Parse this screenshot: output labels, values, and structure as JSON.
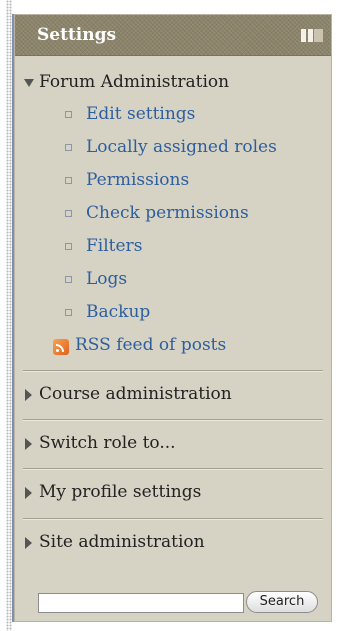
{
  "block": {
    "title": "Settings",
    "dock_icon": "dock-icon"
  },
  "forum_admin": {
    "title": "Forum Administration",
    "items": [
      {
        "label": "Edit settings"
      },
      {
        "label": "Locally assigned roles"
      },
      {
        "label": "Permissions"
      },
      {
        "label": "Check permissions"
      },
      {
        "label": "Filters"
      },
      {
        "label": "Logs"
      },
      {
        "label": "Backup"
      }
    ],
    "rss": {
      "label": "RSS feed of posts",
      "icon": "rss-icon"
    }
  },
  "sections": [
    {
      "label": "Course administration"
    },
    {
      "label": "Switch role to..."
    },
    {
      "label": "My profile settings"
    },
    {
      "label": "Site administration"
    }
  ],
  "search": {
    "value": "",
    "button_label": "Search"
  },
  "colors": {
    "link": "#2d5f9e",
    "header_bg": "#8c846a",
    "block_bg": "#d6d2c4",
    "rss_orange": "#e0621b"
  }
}
